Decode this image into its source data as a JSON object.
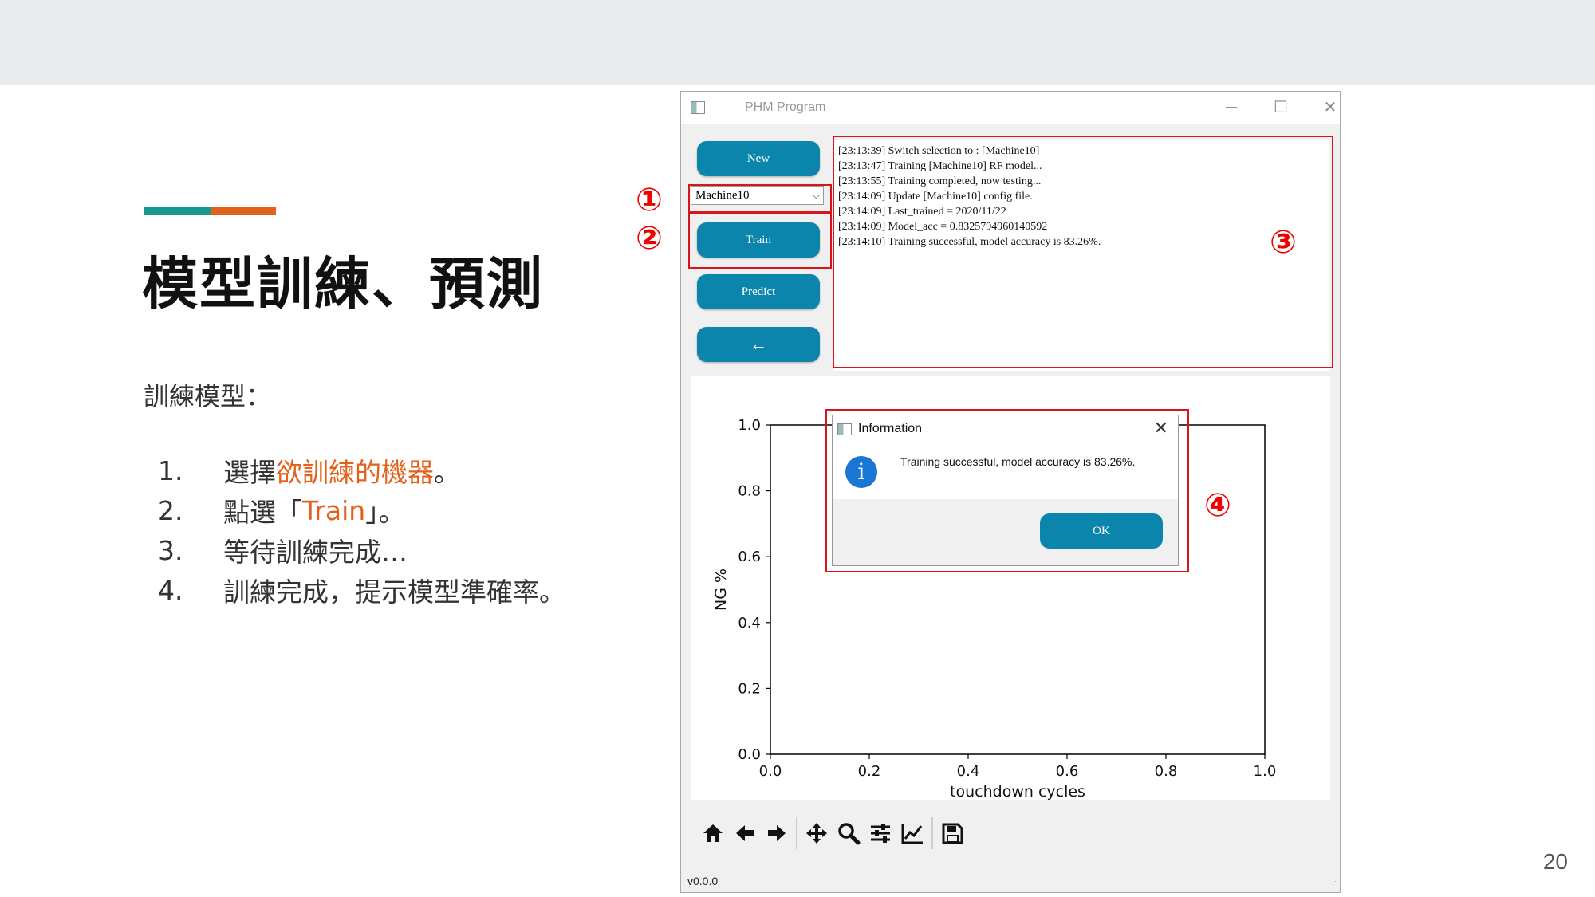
{
  "slide": {
    "title": "模型訓練、預測",
    "intro": "訓練模型：",
    "steps": [
      {
        "num": "1.",
        "pre": "選擇",
        "hl": "欲訓練的機器",
        "post": "。"
      },
      {
        "num": "2.",
        "pre": "點選「",
        "hl": "Train",
        "post": "」。"
      },
      {
        "num": "3.",
        "pre": "等待訓練完成…",
        "hl": "",
        "post": ""
      },
      {
        "num": "4.",
        "pre": "訓練完成，提示模型準確率。",
        "hl": "",
        "post": ""
      }
    ],
    "page_number": "20",
    "callouts": [
      "①",
      "②",
      "③",
      "④"
    ],
    "colors": {
      "teal": "#17998f",
      "orange": "#e2621b",
      "callout_red": "#d9141b",
      "button_blue": "#0b85ab"
    }
  },
  "window": {
    "title": "PHM Program",
    "controls": {
      "minimize": "─",
      "maximize": "☐",
      "close": "✕"
    },
    "buttons": {
      "new": "New",
      "train": "Train",
      "predict": "Predict",
      "back": "←"
    },
    "machine_select": {
      "value": "Machine10"
    },
    "log_lines": [
      "[23:13:39] Switch selection to : [Machine10]",
      "[23:13:47] Training [Machine10] RF model...",
      "[23:13:55] Training completed, now testing...",
      "[23:14:09] Update [Machine10] config file.",
      "[23:14:09] Last_trained = 2020/11/22",
      "[23:14:09] Model_acc = 0.8325794960140592",
      "[23:14:10] Training successful, model accuracy is 83.26%."
    ],
    "version": "v0.0.0",
    "toolbar_icons": [
      "home-icon",
      "back-arrow-icon",
      "forward-arrow-icon",
      "pan-icon",
      "zoom-icon",
      "configure-subplots-icon",
      "edit-axis-icon",
      "save-icon"
    ]
  },
  "dialog": {
    "title": "Information",
    "close": "✕",
    "message": "Training successful, model accuracy is 83.26%.",
    "icon": "info-icon",
    "ok": "OK"
  },
  "chart_data": {
    "type": "line",
    "xlabel": "touchdown cycles",
    "ylabel": "NG %",
    "xlim": [
      0.0,
      1.0
    ],
    "ylim": [
      0.0,
      1.0
    ],
    "xticks": [
      "0.0",
      "0.2",
      "0.4",
      "0.6",
      "0.8",
      "1.0"
    ],
    "yticks": [
      "0.0",
      "0.2",
      "0.4",
      "0.6",
      "0.8",
      "1.0"
    ],
    "series": [],
    "grid": false
  }
}
